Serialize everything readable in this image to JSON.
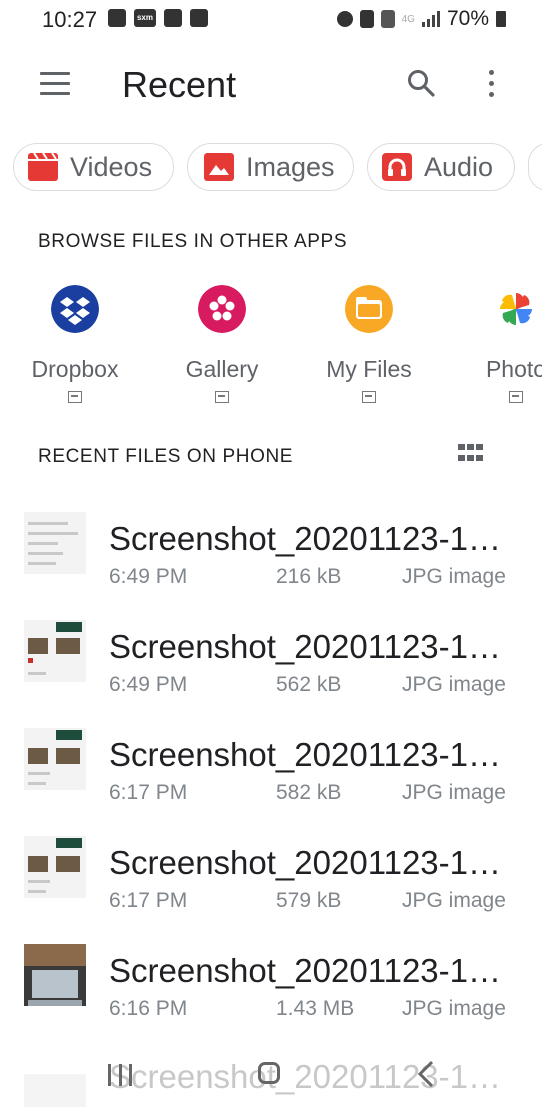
{
  "status_bar": {
    "time": "10:27",
    "left_icons": [
      "a-icon",
      "sxm-icon",
      "nfl-icon",
      "nyt-icon"
    ],
    "sxm_text": "sxm",
    "right_icons": [
      "alarm-icon",
      "lock-icon",
      "wifi-calling-icon",
      "lte-icon",
      "signal-icon",
      "battery-icon"
    ],
    "network": "4G",
    "battery": "70%"
  },
  "app_bar": {
    "title": "Recent",
    "menu_icon": "hamburger-menu-icon",
    "search_icon": "search-icon",
    "more_icon": "more-vert-icon"
  },
  "filter_chips": [
    {
      "label": "Videos",
      "icon": "video-icon",
      "color": "#e53935"
    },
    {
      "label": "Images",
      "icon": "image-icon",
      "color": "#e53935"
    },
    {
      "label": "Audio",
      "icon": "headphones-icon",
      "color": "#e53935"
    }
  ],
  "browse_section": {
    "title": "BROWSE FILES IN OTHER APPS",
    "apps": [
      {
        "name": "Dropbox",
        "icon": "dropbox-icon",
        "color": "#1b3fa0"
      },
      {
        "name": "Gallery",
        "icon": "gallery-icon",
        "color": "#d81b60"
      },
      {
        "name": "My Files",
        "icon": "folder-icon",
        "color": "#f9a825"
      },
      {
        "name": "Photo",
        "icon": "photos-pinwheel-icon",
        "color": "#4285f4"
      }
    ]
  },
  "recent_section": {
    "title": "RECENT FILES ON PHONE",
    "view_toggle_icon": "grid-view-icon"
  },
  "files": [
    {
      "name": "Screenshot_20201123-1…",
      "time": "6:49 PM",
      "size": "216 kB",
      "type": "JPG image"
    },
    {
      "name": "Screenshot_20201123-1…",
      "time": "6:49 PM",
      "size": "562 kB",
      "type": "JPG image"
    },
    {
      "name": "Screenshot_20201123-1…",
      "time": "6:17 PM",
      "size": "582 kB",
      "type": "JPG image"
    },
    {
      "name": "Screenshot_20201123-1…",
      "time": "6:17 PM",
      "size": "579 kB",
      "type": "JPG image"
    },
    {
      "name": "Screenshot_20201123-1…",
      "time": "6:16 PM",
      "size": "1.43 MB",
      "type": "JPG image"
    }
  ],
  "partial_file": {
    "name": "Screenshot_20201123-1…"
  },
  "nav_bar": {
    "recents_icon": "recents-icon",
    "home_icon": "home-icon",
    "back_icon": "back-icon"
  }
}
